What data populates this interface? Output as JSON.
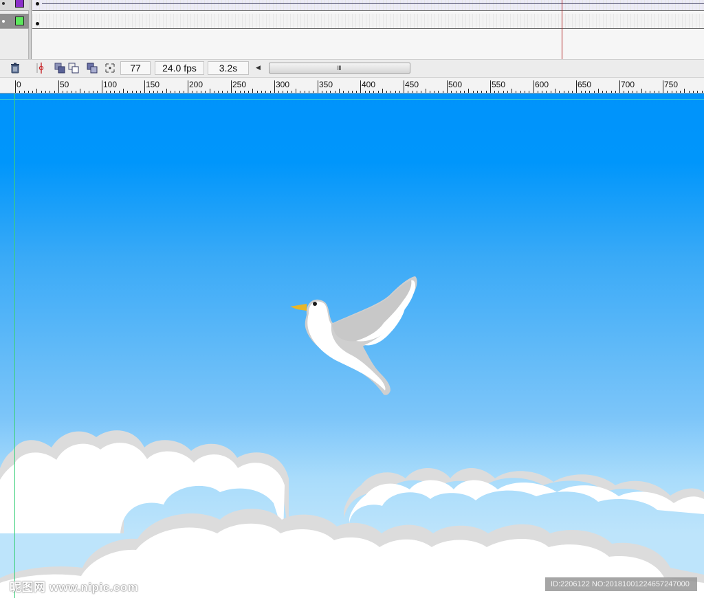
{
  "timeline": {
    "layers": [
      {
        "swatch_color": "#8b2fc9"
      },
      {
        "swatch_color": "#5de85d"
      }
    ]
  },
  "statusbar": {
    "current_frame": "77",
    "frame_rate": "24.0 fps",
    "elapsed_time": "3.2s"
  },
  "ruler": {
    "labels": [
      "0",
      "50",
      "100",
      "150",
      "200",
      "250",
      "300",
      "350",
      "400",
      "450",
      "500",
      "550",
      "600",
      "650",
      "700",
      "750"
    ]
  },
  "stage": {
    "sky_color": "#0096fb",
    "cloud_color": "#ffffff",
    "cloud_shadow_color": "#dcdcdc"
  },
  "watermark": {
    "left": "昵图网 www.nipic.com",
    "right": "ID:2206122 NO:20181001224657247000"
  }
}
